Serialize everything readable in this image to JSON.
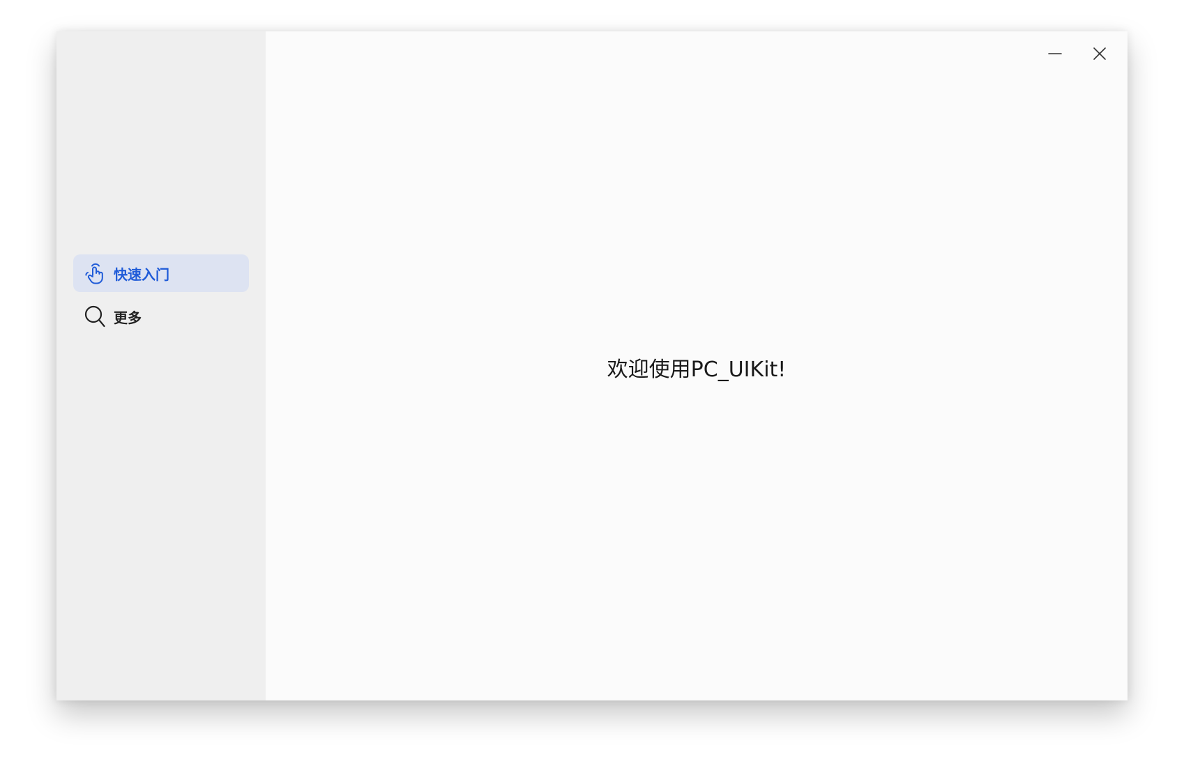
{
  "window": {
    "minimize_label": "minimize",
    "close_label": "close"
  },
  "sidebar": {
    "items": [
      {
        "label": "快速入门",
        "icon": "touch-hand-icon",
        "active": true
      },
      {
        "label": "更多",
        "icon": "search-icon",
        "active": false
      }
    ]
  },
  "main": {
    "welcome_text": "欢迎使用PC_UIKit!"
  },
  "colors": {
    "accent": "#1f5bd8",
    "active_bg": "#dde3f2",
    "sidebar_bg": "#efefef",
    "content_bg": "#fbfbfb"
  }
}
